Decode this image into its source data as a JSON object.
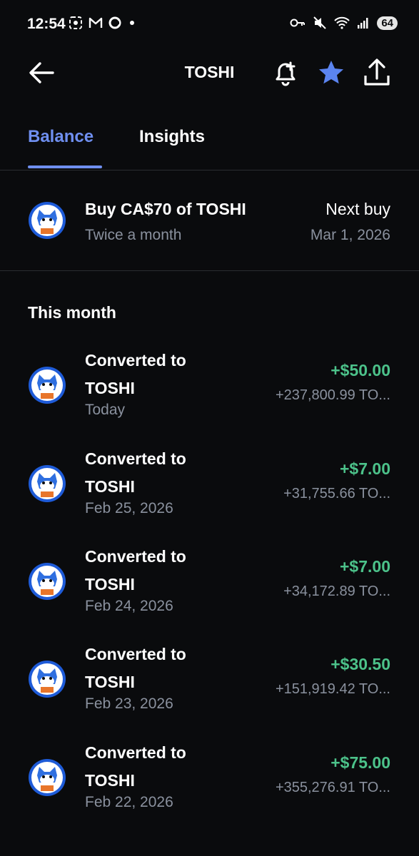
{
  "status": {
    "time": "12:54",
    "battery": "64"
  },
  "header": {
    "title": "TOSHI",
    "icons": [
      "back-arrow-icon",
      "bell-plus-icon",
      "star-icon",
      "share-icon"
    ],
    "accent": "#5b84f0"
  },
  "tabs": [
    {
      "label": "Balance",
      "active": true
    },
    {
      "label": "Insights",
      "active": false
    }
  ],
  "recurring": {
    "title": "Buy CA$70 of TOSHI",
    "frequency": "Twice a month",
    "next_label": "Next buy",
    "next_date": "Mar 1, 2026"
  },
  "section": {
    "title": "This month"
  },
  "transactions": [
    {
      "title": "Converted to TOSHI",
      "date": "Today",
      "amount": "+$50.00",
      "quantity": "+237,800.99 TO..."
    },
    {
      "title": "Converted to TOSHI",
      "date": "Feb 25, 2026",
      "amount": "+$7.00",
      "quantity": "+31,755.66 TO..."
    },
    {
      "title": "Converted to TOSHI",
      "date": "Feb 24, 2026",
      "amount": "+$7.00",
      "quantity": "+34,172.89 TO..."
    },
    {
      "title": "Converted to TOSHI",
      "date": "Feb 23, 2026",
      "amount": "+$30.50",
      "quantity": "+151,919.42 TO..."
    },
    {
      "title": "Converted to TOSHI",
      "date": "Feb 22, 2026",
      "amount": "+$75.00",
      "quantity": "+355,276.91 TO..."
    }
  ],
  "colors": {
    "background": "#0a0b0d",
    "positive": "#4cc28a",
    "muted": "#8a919e",
    "tab_active": "#6f8ff0"
  }
}
